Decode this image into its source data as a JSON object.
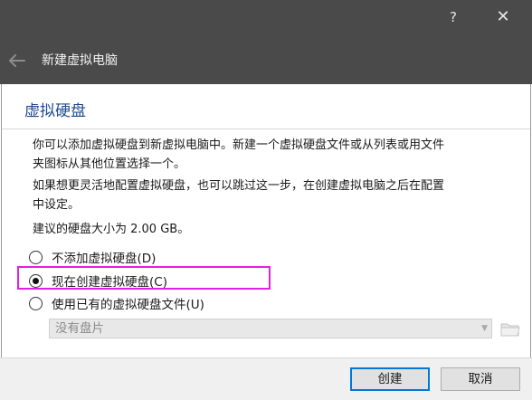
{
  "titlebar": {
    "help_label": "?",
    "close_label": "✕",
    "title": "新建虚拟电脑",
    "back_icon": "arrow-left-icon"
  },
  "section": {
    "title": "虚拟硬盘"
  },
  "text": {
    "p1_line1": "你可以添加虚拟硬盘到新虚拟电脑中。新建一个虚拟硬盘文件或从列表或用文件",
    "p1_line2": "夹图标从其他位置选择一个。",
    "p2_line1": "如果想更灵活地配置虚拟硬盘，也可以跳过这一步，在创建虚拟电脑之后在配置",
    "p2_line2": "中设定。",
    "recommend": "建议的硬盘大小为 2.00 GB。"
  },
  "options": [
    {
      "label": "不添加虚拟硬盘(D)",
      "checked": false
    },
    {
      "label": "现在创建虚拟硬盘(C)",
      "checked": true
    },
    {
      "label": "使用已有的虚拟硬盘文件(U)",
      "checked": false
    }
  ],
  "combo": {
    "value": "没有盘片"
  },
  "buttons": {
    "create": "创建",
    "cancel": "取消"
  },
  "colors": {
    "titlebar": "#4a4a4a",
    "section_title": "#1f4a8f",
    "highlight": "#e020e0",
    "default_button_border": "#0078d7"
  }
}
